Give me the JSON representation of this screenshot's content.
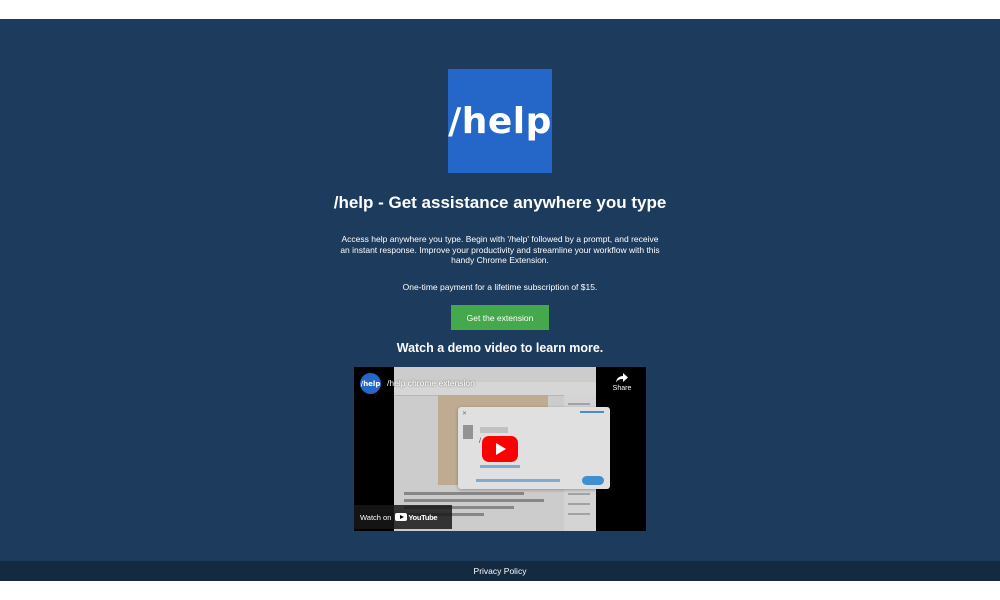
{
  "logo": {
    "text": "/help"
  },
  "hero": {
    "title": "/help - Get assistance anywhere you type",
    "description": "Access help anywhere you type. Begin with '/help' followed by a prompt, and receive an instant response. Improve your productivity and streamline your workflow with this handy Chrome Extension.",
    "payment": "One-time payment for a lifetime subscription of $15.",
    "cta_label": "Get the extension"
  },
  "demo": {
    "heading": "Watch a demo video to learn more.",
    "video": {
      "channel_avatar_text": "/help",
      "title": "/help chrome extension",
      "share_label": "Share",
      "watch_on_label": "Watch on",
      "youtube_logo_text": "YouTube"
    }
  },
  "footer": {
    "privacy_label": "Privacy Policy"
  },
  "colors": {
    "background": "#1d3b5c",
    "footer": "#142a40",
    "logo_bg": "#2467c8",
    "cta": "#46a84c",
    "play": "#ff0000"
  }
}
